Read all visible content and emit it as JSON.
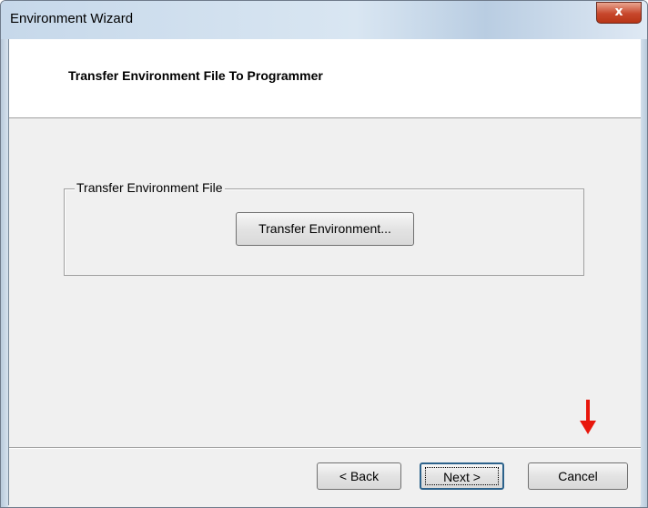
{
  "window": {
    "title": "Environment Wizard",
    "close_glyph": "x"
  },
  "header": {
    "title": "Transfer Environment File To Programmer"
  },
  "group": {
    "label": "Transfer Environment File",
    "transfer_button": "Transfer Environment..."
  },
  "footer": {
    "back_label": "< Back",
    "next_label": "Next >",
    "cancel_label": "Cancel"
  },
  "annotation": {
    "arrow_color": "#e8170c"
  }
}
